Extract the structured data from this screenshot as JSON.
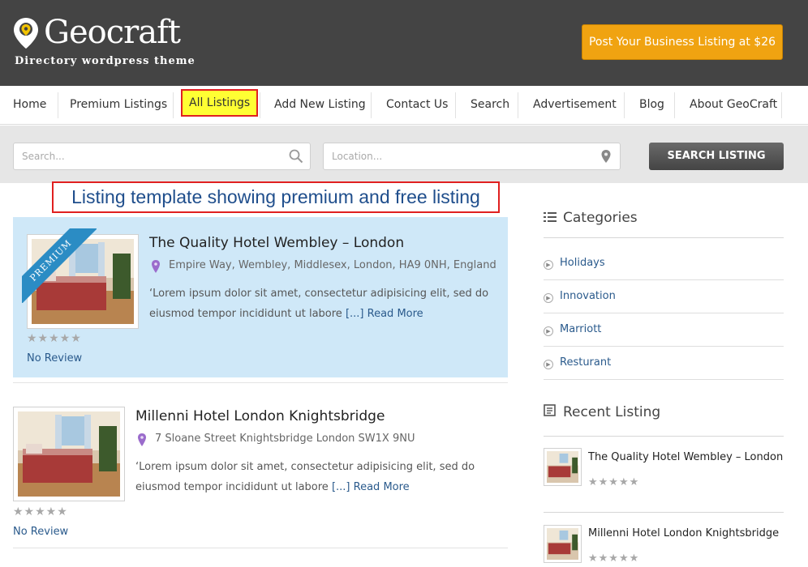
{
  "header": {
    "logo_text": "Geocraft",
    "tagline": "Directory wordpress theme",
    "post_button": "Post Your Business Listing at $26"
  },
  "nav": {
    "items": [
      "Home",
      "Premium Listings",
      "All Listings",
      "Add New Listing",
      "Contact Us",
      "Search",
      "Advertisement",
      "Blog",
      "About GeoCraft"
    ],
    "active": "All Listings"
  },
  "search": {
    "keyword_placeholder": "Search...",
    "location_placeholder": "Location...",
    "button": "SEARCH LISTING"
  },
  "annotation": "Listing template showing premium and free listing",
  "listings": [
    {
      "title": "The Quality Hotel Wembley – London",
      "address": "Empire Way, Wembley, Middlesex, London, HA9 0NH, England",
      "desc_1": "‘Lorem ipsum dolor sit amet, consectetur adipisicing elit, sed do",
      "desc_2": "eiusmod tempor incididunt ut labore",
      "ellipsis": "[...]",
      "read_more": "Read More",
      "stars": "★★★★★",
      "review": "No Review",
      "badge": "PREMIUM"
    },
    {
      "title": "Millenni Hotel London Knightsbridge",
      "address": "7 Sloane Street Knightsbridge London SW1X 9NU",
      "desc_1": "‘Lorem ipsum dolor sit amet, consectetur adipisicing elit, sed do",
      "desc_2": "eiusmod tempor incididunt ut labore",
      "ellipsis": "[...]",
      "read_more": "Read More",
      "stars": "★★★★★",
      "review": "No Review"
    }
  ],
  "sidebar": {
    "categories_title": "Categories",
    "categories": [
      "Holidays",
      "Innovation",
      "Marriott",
      "Resturant"
    ],
    "recent_title": "Recent Listing",
    "recent": [
      {
        "title": "The Quality Hotel Wembley – London",
        "stars": "★★★★★"
      },
      {
        "title": "Millenni Hotel London Knightsbridge",
        "stars": "★★★★★"
      }
    ]
  },
  "colors": {
    "header_bg": "#444444",
    "accent_button": "#f0a311",
    "premium_bg": "#cfe8f8",
    "link": "#2a5a8c",
    "active_nav_bg": "#ffff33"
  }
}
